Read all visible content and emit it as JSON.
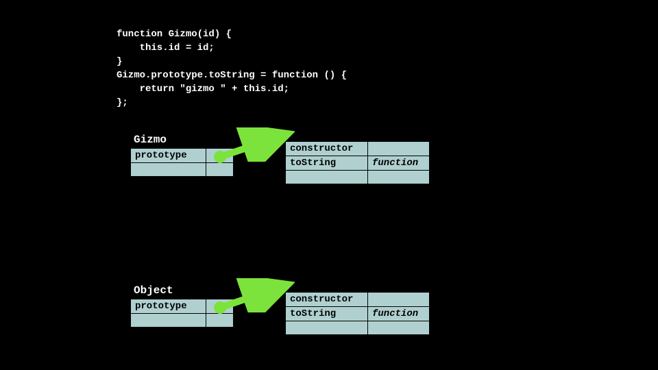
{
  "code": {
    "l1": "function Gizmo(id) {",
    "l2": "    this.id = id;",
    "l3": "}",
    "l4": "Gizmo.prototype.toString = function () {",
    "l5": "    return \"gizmo \" + this.id;",
    "l6": "};"
  },
  "gizmo": {
    "title": "Gizmo",
    "prop": "prototype",
    "target": {
      "r1": "constructor",
      "r2": "toString",
      "v2": "function"
    }
  },
  "object": {
    "title": "Object",
    "prop": "prototype",
    "target": {
      "r1": "constructor",
      "r2": "toString",
      "v2": "function"
    }
  }
}
